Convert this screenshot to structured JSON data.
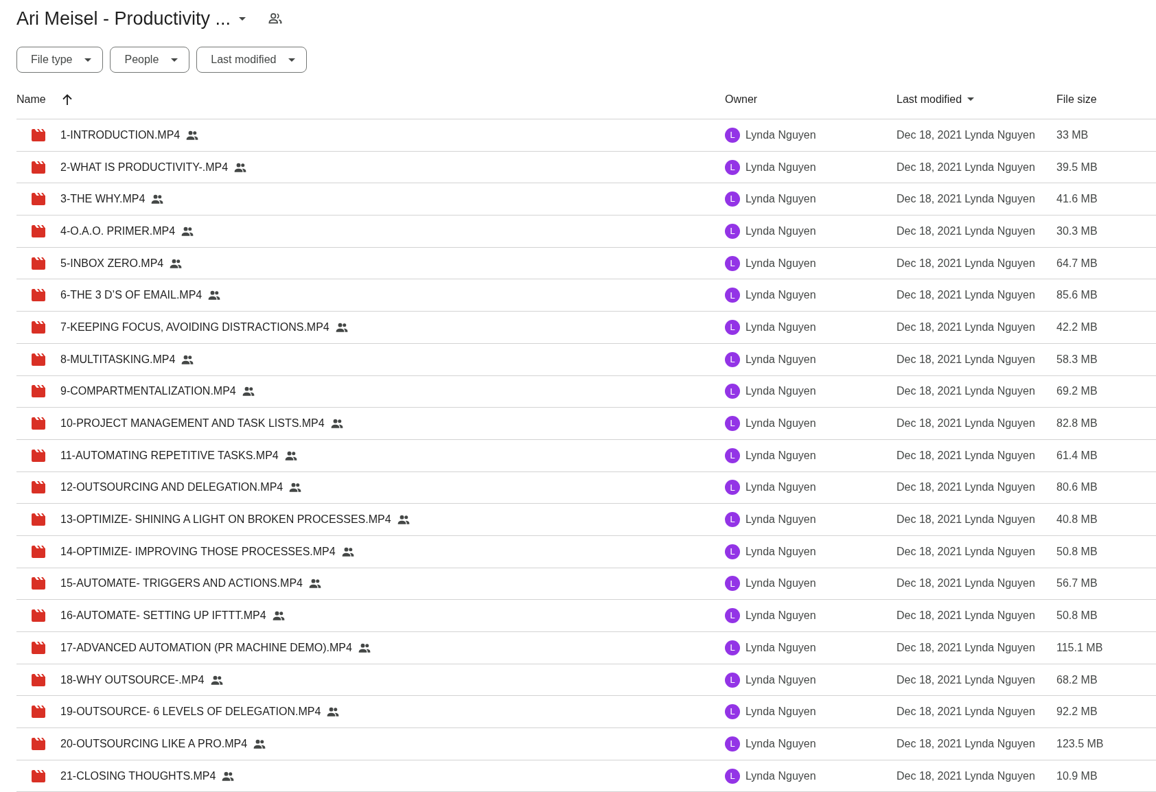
{
  "folder": {
    "title": "Ari Meisel - Productivity ...",
    "shared": true
  },
  "filters": [
    {
      "label": "File type"
    },
    {
      "label": "People"
    },
    {
      "label": "Last modified"
    }
  ],
  "table": {
    "columns": [
      "Name",
      "Owner",
      "Last modified",
      "File size"
    ],
    "rows": [
      {
        "name": "1-INTRODUCTION.MP4",
        "shared": true,
        "avatar": "L",
        "owner": "Lynda Nguyen",
        "modified": "Dec 18, 2021",
        "modified_by": "Lynda Nguyen",
        "size": "33 MB"
      },
      {
        "name": "2-WHAT IS PRODUCTIVITY-.MP4",
        "shared": true,
        "avatar": "L",
        "owner": "Lynda Nguyen",
        "modified": "Dec 18, 2021",
        "modified_by": "Lynda Nguyen",
        "size": "39.5 MB"
      },
      {
        "name": "3-THE WHY.MP4",
        "shared": true,
        "avatar": "L",
        "owner": "Lynda Nguyen",
        "modified": "Dec 18, 2021",
        "modified_by": "Lynda Nguyen",
        "size": "41.6 MB"
      },
      {
        "name": "4-O.A.O. PRIMER.MP4",
        "shared": true,
        "avatar": "L",
        "owner": "Lynda Nguyen",
        "modified": "Dec 18, 2021",
        "modified_by": "Lynda Nguyen",
        "size": "30.3 MB"
      },
      {
        "name": "5-INBOX ZERO.MP4",
        "shared": true,
        "avatar": "L",
        "owner": "Lynda Nguyen",
        "modified": "Dec 18, 2021",
        "modified_by": "Lynda Nguyen",
        "size": "64.7 MB"
      },
      {
        "name": "6-THE 3 D’S OF EMAIL.MP4",
        "shared": true,
        "avatar": "L",
        "owner": "Lynda Nguyen",
        "modified": "Dec 18, 2021",
        "modified_by": "Lynda Nguyen",
        "size": "85.6 MB"
      },
      {
        "name": "7-KEEPING FOCUS, AVOIDING DISTRACTIONS.MP4",
        "shared": true,
        "avatar": "L",
        "owner": "Lynda Nguyen",
        "modified": "Dec 18, 2021",
        "modified_by": "Lynda Nguyen",
        "size": "42.2 MB"
      },
      {
        "name": "8-MULTITASKING.MP4",
        "shared": true,
        "avatar": "L",
        "owner": "Lynda Nguyen",
        "modified": "Dec 18, 2021",
        "modified_by": "Lynda Nguyen",
        "size": "58.3 MB"
      },
      {
        "name": "9-COMPARTMENTALIZATION.MP4",
        "shared": true,
        "avatar": "L",
        "owner": "Lynda Nguyen",
        "modified": "Dec 18, 2021",
        "modified_by": "Lynda Nguyen",
        "size": "69.2 MB"
      },
      {
        "name": "10-PROJECT MANAGEMENT AND TASK LISTS.MP4",
        "shared": true,
        "avatar": "L",
        "owner": "Lynda Nguyen",
        "modified": "Dec 18, 2021",
        "modified_by": "Lynda Nguyen",
        "size": "82.8 MB"
      },
      {
        "name": "11-AUTOMATING REPETITIVE TASKS.MP4",
        "shared": true,
        "avatar": "L",
        "owner": "Lynda Nguyen",
        "modified": "Dec 18, 2021",
        "modified_by": "Lynda Nguyen",
        "size": "61.4 MB"
      },
      {
        "name": "12-OUTSOURCING AND DELEGATION.MP4",
        "shared": true,
        "avatar": "L",
        "owner": "Lynda Nguyen",
        "modified": "Dec 18, 2021",
        "modified_by": "Lynda Nguyen",
        "size": "80.6 MB"
      },
      {
        "name": "13-OPTIMIZE- SHINING A LIGHT ON BROKEN PROCESSES.MP4",
        "shared": true,
        "avatar": "L",
        "owner": "Lynda Nguyen",
        "modified": "Dec 18, 2021",
        "modified_by": "Lynda Nguyen",
        "size": "40.8 MB"
      },
      {
        "name": "14-OPTIMIZE- IMPROVING THOSE PROCESSES.MP4",
        "shared": true,
        "avatar": "L",
        "owner": "Lynda Nguyen",
        "modified": "Dec 18, 2021",
        "modified_by": "Lynda Nguyen",
        "size": "50.8 MB"
      },
      {
        "name": "15-AUTOMATE- TRIGGERS AND ACTIONS.MP4",
        "shared": true,
        "avatar": "L",
        "owner": "Lynda Nguyen",
        "modified": "Dec 18, 2021",
        "modified_by": "Lynda Nguyen",
        "size": "56.7 MB"
      },
      {
        "name": "16-AUTOMATE- SETTING UP IFTTT.MP4",
        "shared": true,
        "avatar": "L",
        "owner": "Lynda Nguyen",
        "modified": "Dec 18, 2021",
        "modified_by": "Lynda Nguyen",
        "size": "50.8 MB"
      },
      {
        "name": "17-ADVANCED AUTOMATION (PR MACHINE DEMO).MP4",
        "shared": true,
        "avatar": "L",
        "owner": "Lynda Nguyen",
        "modified": "Dec 18, 2021",
        "modified_by": "Lynda Nguyen",
        "size": "115.1 MB"
      },
      {
        "name": "18-WHY OUTSOURCE-.MP4",
        "shared": true,
        "avatar": "L",
        "owner": "Lynda Nguyen",
        "modified": "Dec 18, 2021",
        "modified_by": "Lynda Nguyen",
        "size": "68.2 MB"
      },
      {
        "name": "19-OUTSOURCE- 6 LEVELS OF DELEGATION.MP4",
        "shared": true,
        "avatar": "L",
        "owner": "Lynda Nguyen",
        "modified": "Dec 18, 2021",
        "modified_by": "Lynda Nguyen",
        "size": "92.2 MB"
      },
      {
        "name": "20-OUTSOURCING LIKE A PRO.MP4",
        "shared": true,
        "avatar": "L",
        "owner": "Lynda Nguyen",
        "modified": "Dec 18, 2021",
        "modified_by": "Lynda Nguyen",
        "size": "123.5 MB"
      },
      {
        "name": "21-CLOSING THOUGHTS.MP4",
        "shared": true,
        "avatar": "L",
        "owner": "Lynda Nguyen",
        "modified": "Dec 18, 2021",
        "modified_by": "Lynda Nguyen",
        "size": "10.9 MB"
      }
    ]
  }
}
